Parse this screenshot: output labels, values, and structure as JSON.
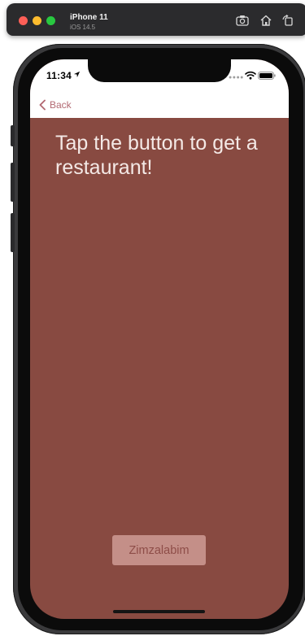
{
  "simulator": {
    "device_name": "iPhone 11",
    "os_version": "iOS 14.5",
    "toolbar_icons": [
      "screenshot-icon",
      "home-icon",
      "rotate-icon"
    ]
  },
  "status_bar": {
    "time": "11:34",
    "icons": [
      "location-arrow-icon",
      "signal-dots-icon",
      "wifi-icon",
      "battery-icon"
    ]
  },
  "nav": {
    "back_label": "Back"
  },
  "content": {
    "headline": "Tap the button to get a restaurant!",
    "button_label": "Zimzalabim"
  },
  "colors": {
    "screen_background": "#884a41",
    "accent_back": "#b36a73",
    "button_background": "#c48f88",
    "button_text": "#8e4d48",
    "headline_text": "#f4e9e6"
  }
}
